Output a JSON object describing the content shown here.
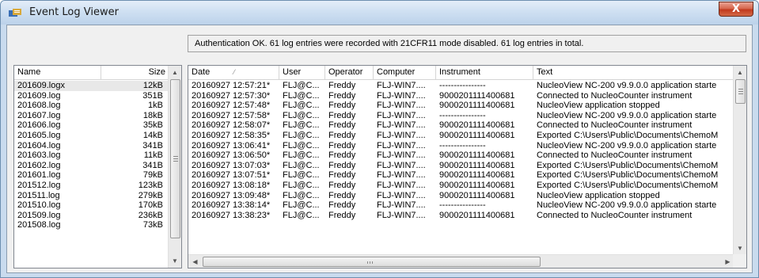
{
  "window": {
    "title": "Event Log Viewer",
    "close_label": "X"
  },
  "status": {
    "message": "Authentication OK. 61 log entries were recorded with 21CFR11 mode disabled.  61 log entries in total."
  },
  "file_list": {
    "columns": [
      "Name",
      "Size"
    ],
    "selected_index": 0,
    "rows": [
      {
        "name": "201609.logx",
        "size": "12kB"
      },
      {
        "name": "201609.log",
        "size": "351B"
      },
      {
        "name": "201608.log",
        "size": "1kB"
      },
      {
        "name": "201607.log",
        "size": "18kB"
      },
      {
        "name": "201606.log",
        "size": "35kB"
      },
      {
        "name": "201605.log",
        "size": "14kB"
      },
      {
        "name": "201604.log",
        "size": "341B"
      },
      {
        "name": "201603.log",
        "size": "11kB"
      },
      {
        "name": "201602.log",
        "size": "341B"
      },
      {
        "name": "201601.log",
        "size": "79kB"
      },
      {
        "name": "201512.log",
        "size": "123kB"
      },
      {
        "name": "201511.log",
        "size": "279kB"
      },
      {
        "name": "201510.log",
        "size": "170kB"
      },
      {
        "name": "201509.log",
        "size": "236kB"
      },
      {
        "name": "201508.log",
        "size": "73kB"
      }
    ]
  },
  "log_list": {
    "columns": [
      "Date",
      "User",
      "Operator",
      "Computer",
      "Instrument",
      "Text"
    ],
    "rows": [
      {
        "date": "20160927 12:57:21*",
        "user": "FLJ@C...",
        "operator": "Freddy",
        "computer": "FLJ-WIN7....",
        "instrument": "----------------",
        "text": "NucleoView NC-200 v9.9.0.0 application starte"
      },
      {
        "date": "20160927 12:57:30*",
        "user": "FLJ@C...",
        "operator": "Freddy",
        "computer": "FLJ-WIN7....",
        "instrument": "9000201111400681",
        "text": "Connected to NucleoCounter instrument"
      },
      {
        "date": "20160927 12:57:48*",
        "user": "FLJ@C...",
        "operator": "Freddy",
        "computer": "FLJ-WIN7....",
        "instrument": "9000201111400681",
        "text": "NucleoView application stopped"
      },
      {
        "date": "20160927 12:57:58*",
        "user": "FLJ@C...",
        "operator": "Freddy",
        "computer": "FLJ-WIN7....",
        "instrument": "----------------",
        "text": "NucleoView NC-200 v9.9.0.0 application starte"
      },
      {
        "date": "20160927 12:58:07*",
        "user": "FLJ@C...",
        "operator": "Freddy",
        "computer": "FLJ-WIN7....",
        "instrument": "9000201111400681",
        "text": "Connected to NucleoCounter instrument"
      },
      {
        "date": "20160927 12:58:35*",
        "user": "FLJ@C...",
        "operator": "Freddy",
        "computer": "FLJ-WIN7....",
        "instrument": "9000201111400681",
        "text": "Exported C:\\Users\\Public\\Documents\\ChemoM"
      },
      {
        "date": "20160927 13:06:41*",
        "user": "FLJ@C...",
        "operator": "Freddy",
        "computer": "FLJ-WIN7....",
        "instrument": "----------------",
        "text": "NucleoView NC-200 v9.9.0.0 application starte"
      },
      {
        "date": "20160927 13:06:50*",
        "user": "FLJ@C...",
        "operator": "Freddy",
        "computer": "FLJ-WIN7....",
        "instrument": "9000201111400681",
        "text": "Connected to NucleoCounter instrument"
      },
      {
        "date": "20160927 13:07:03*",
        "user": "FLJ@C...",
        "operator": "Freddy",
        "computer": "FLJ-WIN7....",
        "instrument": "9000201111400681",
        "text": "Exported C:\\Users\\Public\\Documents\\ChemoM"
      },
      {
        "date": "20160927 13:07:51*",
        "user": "FLJ@C...",
        "operator": "Freddy",
        "computer": "FLJ-WIN7....",
        "instrument": "9000201111400681",
        "text": "Exported C:\\Users\\Public\\Documents\\ChemoM"
      },
      {
        "date": "20160927 13:08:18*",
        "user": "FLJ@C...",
        "operator": "Freddy",
        "computer": "FLJ-WIN7....",
        "instrument": "9000201111400681",
        "text": "Exported C:\\Users\\Public\\Documents\\ChemoM"
      },
      {
        "date": "20160927 13:09:48*",
        "user": "FLJ@C...",
        "operator": "Freddy",
        "computer": "FLJ-WIN7....",
        "instrument": "9000201111400681",
        "text": "NucleoView application stopped"
      },
      {
        "date": "20160927 13:38:14*",
        "user": "FLJ@C...",
        "operator": "Freddy",
        "computer": "FLJ-WIN7....",
        "instrument": "----------------",
        "text": "NucleoView NC-200 v9.9.0.0 application starte"
      },
      {
        "date": "20160927 13:38:23*",
        "user": "FLJ@C...",
        "operator": "Freddy",
        "computer": "FLJ-WIN7....",
        "instrument": "9000201111400681",
        "text": "Connected to NucleoCounter instrument"
      }
    ]
  },
  "icons": {
    "app": "event-log-icon",
    "close": "close-icon",
    "scroll_up": "arrow-up-icon",
    "scroll_down": "arrow-down-icon",
    "scroll_left": "arrow-left-icon",
    "scroll_right": "arrow-right-icon",
    "sort": "sort-indicator-icon"
  },
  "colors": {
    "title_bar": "#cfe0f2",
    "close_button": "#c13a1e",
    "selection": "#e8e8e8"
  }
}
